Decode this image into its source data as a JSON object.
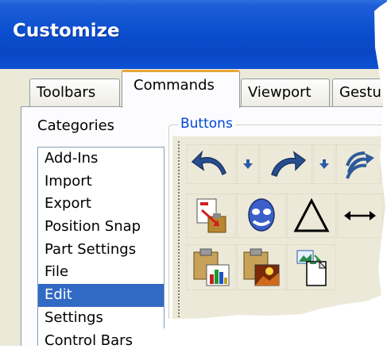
{
  "window": {
    "title": "Customize"
  },
  "tabs": [
    {
      "label": "Toolbars",
      "active": false
    },
    {
      "label": "Commands",
      "active": true
    },
    {
      "label": "Viewport",
      "active": false
    },
    {
      "label": "Gestu",
      "active": false
    }
  ],
  "categories": {
    "label": "Categories",
    "selected": "Edit",
    "items": [
      "Add-Ins",
      "Import",
      "Export",
      "Position Snap",
      "Part Settings",
      "File",
      "Edit",
      "Settings",
      "Control Bars"
    ]
  },
  "buttons": {
    "label": "Buttons",
    "rows": [
      [
        "undo-icon",
        "dropdown-arrow-icon",
        "redo-icon",
        "dropdown-arrow-icon",
        "repeat-icon"
      ],
      [
        "paste-special-icon",
        "mask-icon",
        "triangle-icon",
        "double-arrow-icon"
      ],
      [
        "paste-chart-icon",
        "paste-image-icon",
        "copy-image-icon"
      ]
    ]
  },
  "colors": {
    "titlebar": "#0a46c4",
    "accent_tab": "#e8a63b",
    "selection": "#316ac5",
    "group_label": "#0046d5",
    "panel": "#ece9d8"
  }
}
